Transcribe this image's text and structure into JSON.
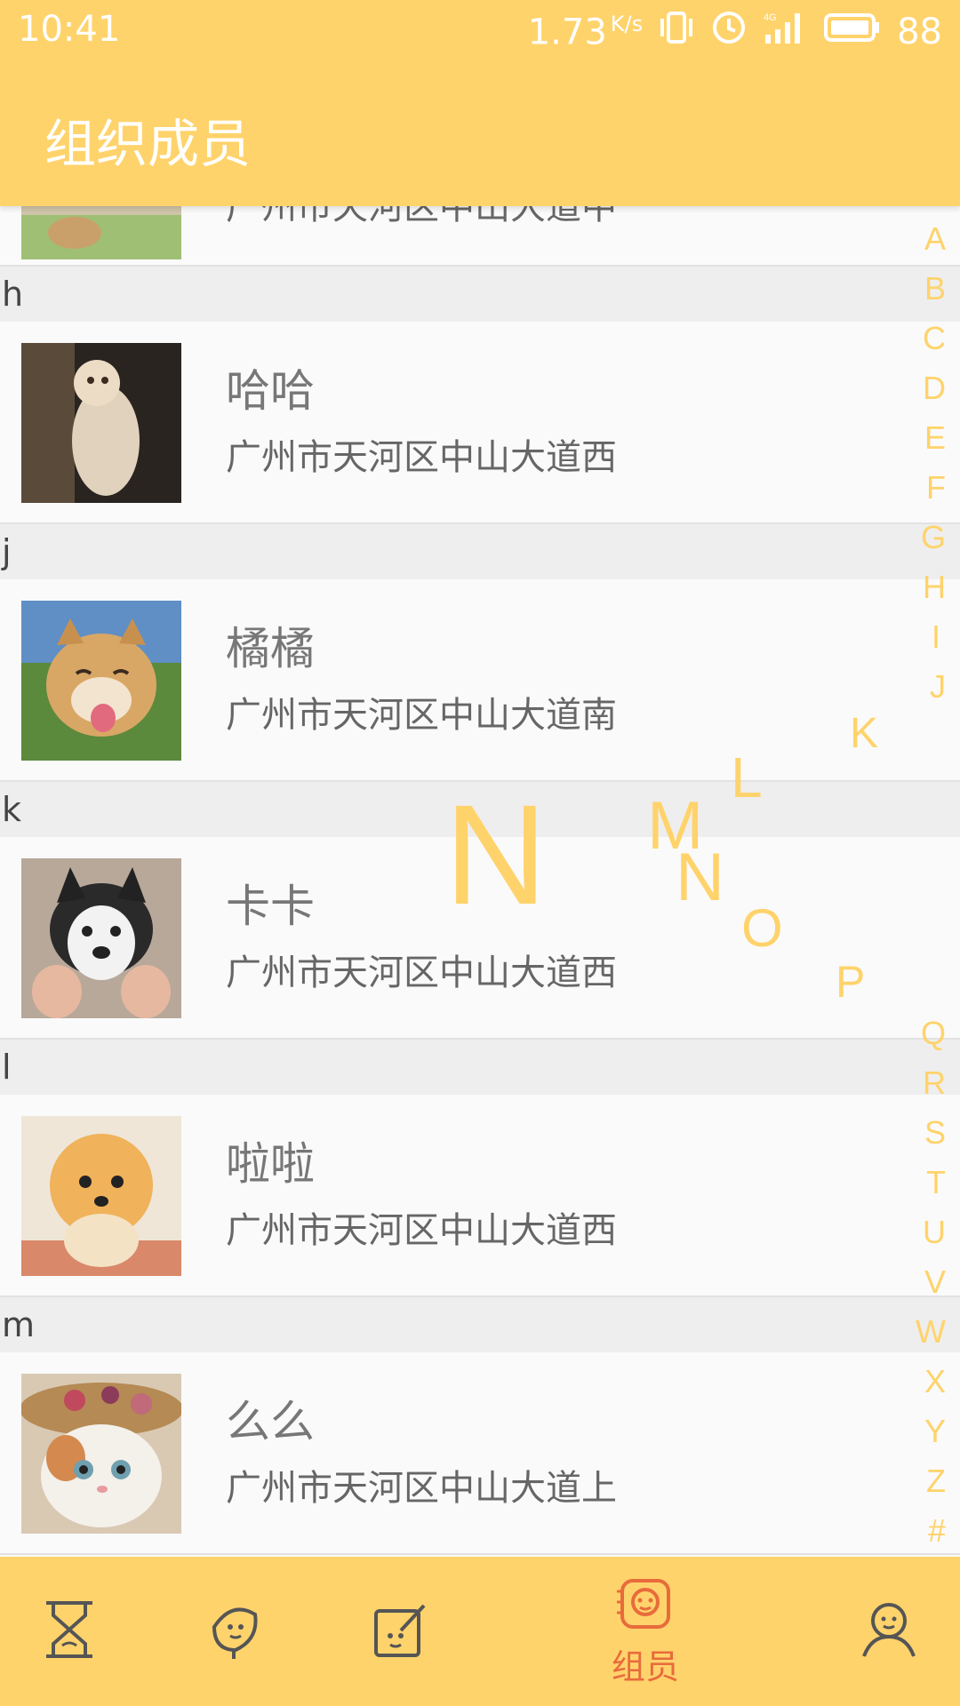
{
  "status": {
    "time": "10:41",
    "speed": "1.73",
    "speed_unit": "K/s",
    "network": "4G",
    "battery": "88"
  },
  "app": {
    "title": "组织成员"
  },
  "partial_row": {
    "address": "广州市天河区中山大道中"
  },
  "groups": [
    {
      "letter": "h",
      "name": "哈哈",
      "address": "广州市天河区中山大道西"
    },
    {
      "letter": "j",
      "name": "橘橘",
      "address": "广州市天河区中山大道南"
    },
    {
      "letter": "k",
      "name": "卡卡",
      "address": "广州市天河区中山大道西"
    },
    {
      "letter": "l",
      "name": "啦啦",
      "address": "广州市天河区中山大道西"
    },
    {
      "letter": "m",
      "name": "么么",
      "address": "广州市天河区中山大道上"
    }
  ],
  "index": [
    "A",
    "B",
    "C",
    "D",
    "E",
    "F",
    "G",
    "H",
    "I",
    "J",
    "K",
    "L",
    "M",
    "N",
    "O",
    "P",
    "Q",
    "R",
    "S",
    "T",
    "U",
    "V",
    "W",
    "X",
    "Y",
    "Z",
    "#"
  ],
  "selected_index": "N",
  "bottom_nav": {
    "active_label": "组员",
    "tabs": [
      "hourglass-icon",
      "leaf-icon",
      "edit-icon",
      "members-icon",
      "profile-icon"
    ]
  },
  "colors": {
    "accent": "#ffd36b",
    "active": "#e86b3c"
  }
}
